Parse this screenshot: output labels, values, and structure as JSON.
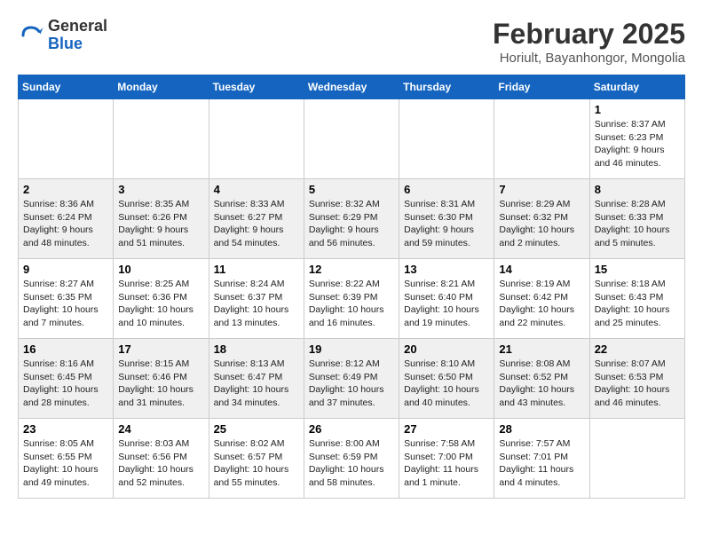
{
  "header": {
    "logo_general": "General",
    "logo_blue": "Blue",
    "month_title": "February 2025",
    "location": "Horiult, Bayanhongor, Mongolia"
  },
  "days_of_week": [
    "Sunday",
    "Monday",
    "Tuesday",
    "Wednesday",
    "Thursday",
    "Friday",
    "Saturday"
  ],
  "weeks": [
    [
      {
        "day": "",
        "info": ""
      },
      {
        "day": "",
        "info": ""
      },
      {
        "day": "",
        "info": ""
      },
      {
        "day": "",
        "info": ""
      },
      {
        "day": "",
        "info": ""
      },
      {
        "day": "",
        "info": ""
      },
      {
        "day": "1",
        "info": "Sunrise: 8:37 AM\nSunset: 6:23 PM\nDaylight: 9 hours and 46 minutes."
      }
    ],
    [
      {
        "day": "2",
        "info": "Sunrise: 8:36 AM\nSunset: 6:24 PM\nDaylight: 9 hours and 48 minutes."
      },
      {
        "day": "3",
        "info": "Sunrise: 8:35 AM\nSunset: 6:26 PM\nDaylight: 9 hours and 51 minutes."
      },
      {
        "day": "4",
        "info": "Sunrise: 8:33 AM\nSunset: 6:27 PM\nDaylight: 9 hours and 54 minutes."
      },
      {
        "day": "5",
        "info": "Sunrise: 8:32 AM\nSunset: 6:29 PM\nDaylight: 9 hours and 56 minutes."
      },
      {
        "day": "6",
        "info": "Sunrise: 8:31 AM\nSunset: 6:30 PM\nDaylight: 9 hours and 59 minutes."
      },
      {
        "day": "7",
        "info": "Sunrise: 8:29 AM\nSunset: 6:32 PM\nDaylight: 10 hours and 2 minutes."
      },
      {
        "day": "8",
        "info": "Sunrise: 8:28 AM\nSunset: 6:33 PM\nDaylight: 10 hours and 5 minutes."
      }
    ],
    [
      {
        "day": "9",
        "info": "Sunrise: 8:27 AM\nSunset: 6:35 PM\nDaylight: 10 hours and 7 minutes."
      },
      {
        "day": "10",
        "info": "Sunrise: 8:25 AM\nSunset: 6:36 PM\nDaylight: 10 hours and 10 minutes."
      },
      {
        "day": "11",
        "info": "Sunrise: 8:24 AM\nSunset: 6:37 PM\nDaylight: 10 hours and 13 minutes."
      },
      {
        "day": "12",
        "info": "Sunrise: 8:22 AM\nSunset: 6:39 PM\nDaylight: 10 hours and 16 minutes."
      },
      {
        "day": "13",
        "info": "Sunrise: 8:21 AM\nSunset: 6:40 PM\nDaylight: 10 hours and 19 minutes."
      },
      {
        "day": "14",
        "info": "Sunrise: 8:19 AM\nSunset: 6:42 PM\nDaylight: 10 hours and 22 minutes."
      },
      {
        "day": "15",
        "info": "Sunrise: 8:18 AM\nSunset: 6:43 PM\nDaylight: 10 hours and 25 minutes."
      }
    ],
    [
      {
        "day": "16",
        "info": "Sunrise: 8:16 AM\nSunset: 6:45 PM\nDaylight: 10 hours and 28 minutes."
      },
      {
        "day": "17",
        "info": "Sunrise: 8:15 AM\nSunset: 6:46 PM\nDaylight: 10 hours and 31 minutes."
      },
      {
        "day": "18",
        "info": "Sunrise: 8:13 AM\nSunset: 6:47 PM\nDaylight: 10 hours and 34 minutes."
      },
      {
        "day": "19",
        "info": "Sunrise: 8:12 AM\nSunset: 6:49 PM\nDaylight: 10 hours and 37 minutes."
      },
      {
        "day": "20",
        "info": "Sunrise: 8:10 AM\nSunset: 6:50 PM\nDaylight: 10 hours and 40 minutes."
      },
      {
        "day": "21",
        "info": "Sunrise: 8:08 AM\nSunset: 6:52 PM\nDaylight: 10 hours and 43 minutes."
      },
      {
        "day": "22",
        "info": "Sunrise: 8:07 AM\nSunset: 6:53 PM\nDaylight: 10 hours and 46 minutes."
      }
    ],
    [
      {
        "day": "23",
        "info": "Sunrise: 8:05 AM\nSunset: 6:55 PM\nDaylight: 10 hours and 49 minutes."
      },
      {
        "day": "24",
        "info": "Sunrise: 8:03 AM\nSunset: 6:56 PM\nDaylight: 10 hours and 52 minutes."
      },
      {
        "day": "25",
        "info": "Sunrise: 8:02 AM\nSunset: 6:57 PM\nDaylight: 10 hours and 55 minutes."
      },
      {
        "day": "26",
        "info": "Sunrise: 8:00 AM\nSunset: 6:59 PM\nDaylight: 10 hours and 58 minutes."
      },
      {
        "day": "27",
        "info": "Sunrise: 7:58 AM\nSunset: 7:00 PM\nDaylight: 11 hours and 1 minute."
      },
      {
        "day": "28",
        "info": "Sunrise: 7:57 AM\nSunset: 7:01 PM\nDaylight: 11 hours and 4 minutes."
      },
      {
        "day": "",
        "info": ""
      }
    ]
  ]
}
